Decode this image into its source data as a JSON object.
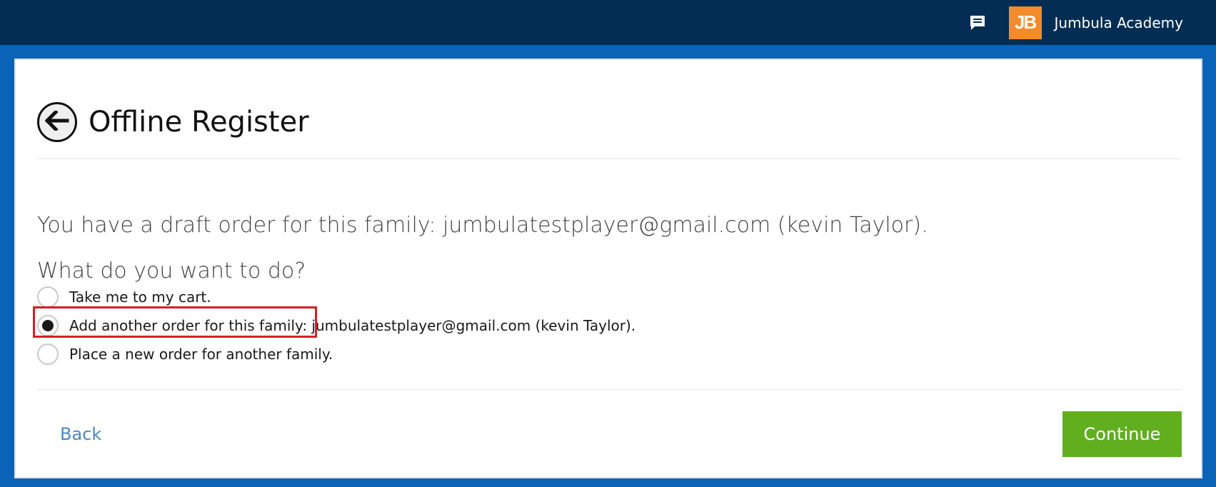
{
  "topbar": {
    "chat_icon": "chat-bubble-icon",
    "logo_text": "JB",
    "academy_name": "Jumbula Academy",
    "logo_color": "#f38b2a",
    "background_color": "#032d52"
  },
  "page": {
    "title": "Offline Register",
    "back_icon": "arrow-left-icon",
    "draft_message": "You have a draft order for this family: jumbulatestplayer@gmail.com (kevin Taylor).",
    "question": "What do you want to do?"
  },
  "options": [
    {
      "label": "Take me to my cart.",
      "selected": false
    },
    {
      "label": "Add another order for this family: jumbulatestplayer@gmail.com (kevin Taylor).",
      "selected": true
    },
    {
      "label": "Place a new order for another family.",
      "selected": false
    }
  ],
  "actions": {
    "back_label": "Back",
    "continue_label": "Continue",
    "continue_color": "#61ae1f",
    "link_color": "#4d88bd"
  }
}
